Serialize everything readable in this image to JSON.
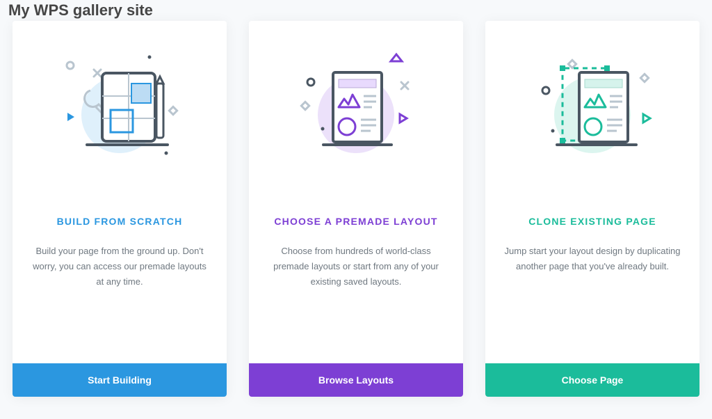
{
  "bg_text": "My WPS gallery site",
  "cards": [
    {
      "title": "BUILD FROM SCRATCH",
      "description": "Build your page from the ground up. Don't worry, you can access our premade layouts at any time.",
      "button": "Start Building"
    },
    {
      "title": "CHOOSE A PREMADE LAYOUT",
      "description": "Choose from hundreds of world-class premade layouts or start from any of your existing saved layouts.",
      "button": "Browse Layouts"
    },
    {
      "title": "CLONE EXISTING PAGE",
      "description": "Jump start your layout design by duplicating another page that you've already built.",
      "button": "Choose Page"
    }
  ]
}
